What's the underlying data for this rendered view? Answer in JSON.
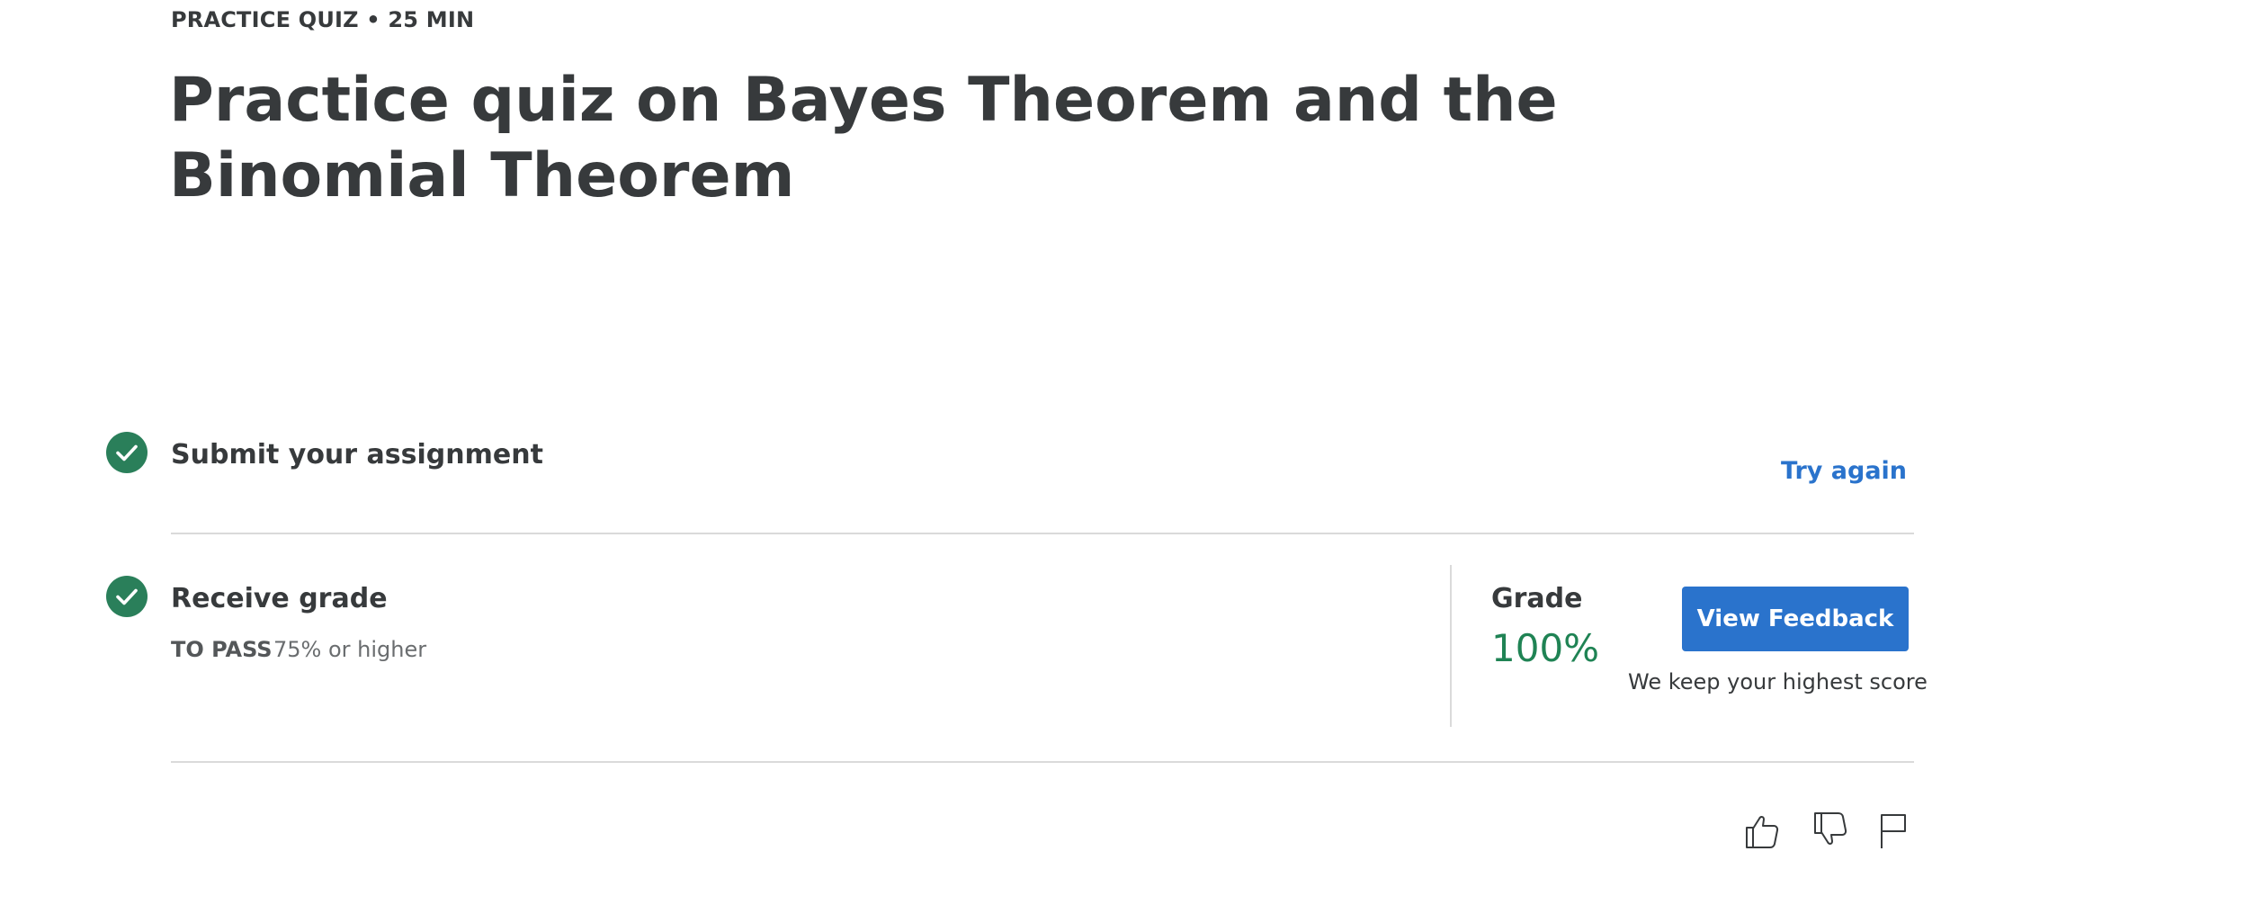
{
  "header": {
    "eyebrow": "PRACTICE QUIZ • 25 MIN",
    "title": "Practice quiz on Bayes Theorem and the Binomial Theorem"
  },
  "steps": {
    "submit": {
      "title": "Submit your assignment",
      "action_label": "Try again"
    },
    "receive": {
      "title": "Receive grade",
      "to_pass_label": "TO PASS",
      "to_pass_value": "75% or higher"
    }
  },
  "grade": {
    "label": "Grade",
    "value": "100%",
    "button_label": "View Feedback",
    "note": "We keep your highest score"
  },
  "icons": {
    "check": "check-icon",
    "like": "thumbs-up-icon",
    "dislike": "thumbs-down-icon",
    "report": "flag-icon"
  },
  "colors": {
    "accent": "#2a73cc",
    "success": "#2a7f5a",
    "grade": "#1f8354",
    "text": "#373a3c"
  }
}
